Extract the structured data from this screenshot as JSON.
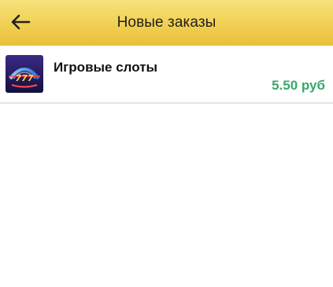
{
  "app_bar": {
    "title": "Новые заказы",
    "back_icon": "arrow-left-icon",
    "background_color": "#f1cf53"
  },
  "orders": [
    {
      "title": "Игровые слоты",
      "price": "5.50 руб",
      "price_color": "#3aa76a",
      "icon": "slots-app-logo"
    }
  ]
}
